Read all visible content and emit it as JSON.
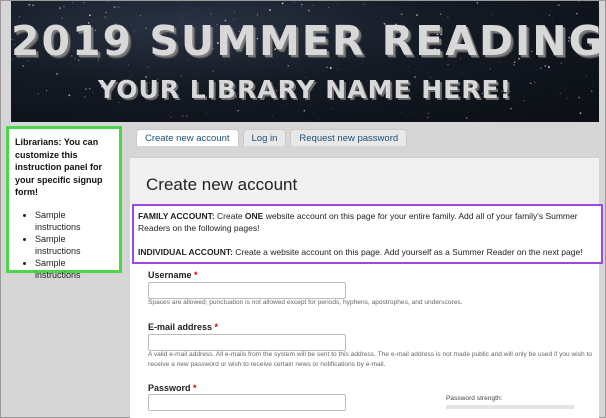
{
  "banner": {
    "title": "2019 SUMMER READING",
    "subtitle": "YOUR LIBRARY NAME HERE!"
  },
  "left_panel": {
    "heading": "Librarians: You can customize this instruction panel for your specific signup form!",
    "items": [
      "Sample instructions",
      "Sample instructions",
      "Sample instructions"
    ]
  },
  "tabs": [
    {
      "label": "Create new account",
      "active": true
    },
    {
      "label": "Log in",
      "active": false
    },
    {
      "label": "Request new password",
      "active": false
    }
  ],
  "main": {
    "title": "Create new account",
    "family": {
      "label": "FAMILY ACCOUNT:",
      "pre": " Create ",
      "emph": "ONE",
      "post": " website account on this page for your entire family.  Add all of your family's Summer Readers on the following pages!"
    },
    "individual": {
      "label": "INDIVIDUAL ACCOUNT:",
      "text": " Create a website account on this page.  Add yourself as a Summer Reader on the next page!"
    }
  },
  "form": {
    "required_marker": "*",
    "username": {
      "label": "Username",
      "value": "",
      "help": "Spaces are allowed; punctuation is not allowed except for periods, hyphens, apostrophes, and underscores."
    },
    "email": {
      "label": "E-mail address",
      "value": "",
      "help": "A valid e-mail address. All e-mails from the system will be sent to this address. The e-mail address is not made public and will only be used if you wish to receive a new password or wish to receive certain news or notifications by e-mail."
    },
    "password": {
      "label": "Password",
      "value": "",
      "strength_label": "Password strength:",
      "strength": 0
    }
  },
  "colors": {
    "left_panel_border": "#4cd64c",
    "account_box_border": "#9b49e0",
    "tab_link": "#1a4f7a",
    "required": "#d60000"
  }
}
